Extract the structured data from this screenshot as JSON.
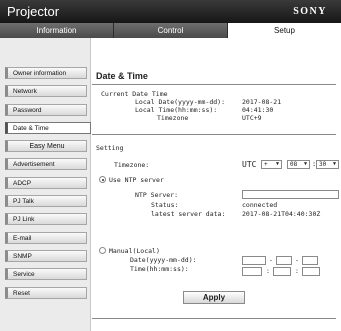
{
  "header": {
    "app_title": "Projector",
    "brand": "SONY"
  },
  "tabs": [
    {
      "label": "Information"
    },
    {
      "label": "Control"
    },
    {
      "label": "Setup"
    }
  ],
  "active_tab": "Setup",
  "sidebar": {
    "items": [
      {
        "label": "Owner information"
      },
      {
        "label": "Network"
      },
      {
        "label": "Password"
      },
      {
        "label": "Date & Time"
      },
      {
        "label": "Easy Menu"
      },
      {
        "label": "Advertisement"
      },
      {
        "label": "ADCP"
      },
      {
        "label": "PJ Talk"
      },
      {
        "label": "PJ Link"
      },
      {
        "label": "E-mail"
      },
      {
        "label": "SNMP"
      },
      {
        "label": "Service"
      },
      {
        "label": "Reset"
      }
    ],
    "active": "Date & Time"
  },
  "main": {
    "title": "Date & Time",
    "current": {
      "heading": "Current Date Time",
      "local_date_label": "Local Date(yyyy-mm-dd):",
      "local_date_value": "2017-08-21",
      "local_time_label": "Local Time(hh:mm:ss):",
      "local_time_value": "04:41:30",
      "timezone_label": "Timezone",
      "timezone_value": "UTC+9"
    },
    "setting": {
      "heading": "Setting",
      "timezone_label": "Timezone:",
      "utc_label": "UTC",
      "sign": "+",
      "hours": "08",
      "colon": ":",
      "minutes": "30",
      "use_ntp_label": "Use NTP server",
      "ntp_server_label": "NTP Server:",
      "ntp_server_value": "",
      "status_label": "Status:",
      "status_value": "connected",
      "latest_label": "latest server data:",
      "latest_value": "2017-08-21T04:40:30Z",
      "manual_label": "Manual(Local)",
      "date_label": "Date(yyyy-mm-dd):",
      "time_label": "Time(hh:mm:ss):",
      "dash": "-",
      "time_sep": ":"
    },
    "apply_label": "Apply"
  }
}
